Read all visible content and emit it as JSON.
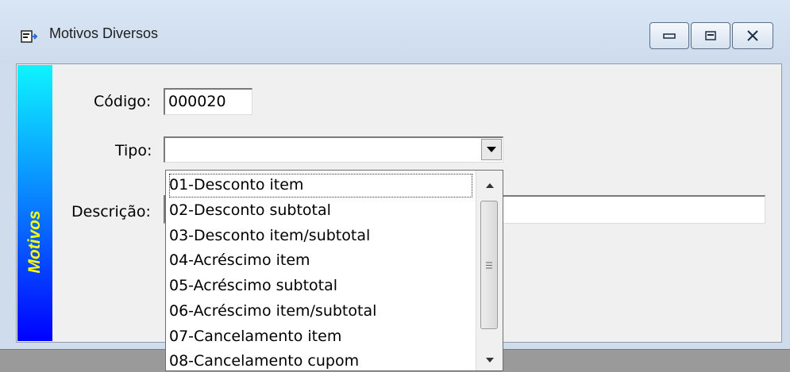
{
  "window": {
    "title": "Motivos Diversos",
    "side_label": "Motivos",
    "minimize_label": "minimize",
    "restore_label": "restore",
    "close_label": "close"
  },
  "form": {
    "codigo_label": "Código:",
    "codigo_value": "000020",
    "tipo_label": "Tipo:",
    "tipo_value": "",
    "descricao_label": "Descrição:",
    "descricao_value": ""
  },
  "tipo_options": [
    "01-Desconto item",
    "02-Desconto subtotal",
    "03-Desconto item/subtotal",
    "04-Acréscimo item",
    "05-Acréscimo subtotal",
    "06-Acréscimo item/subtotal",
    "07-Cancelamento item",
    "08-Cancelamento cupom"
  ],
  "colors": {
    "strip_top": "#0ef4ff",
    "strip_bottom": "#0000ff",
    "strip_text": "#ffff00"
  }
}
